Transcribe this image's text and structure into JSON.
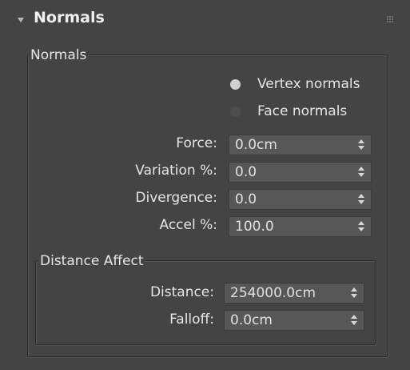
{
  "rollout": {
    "title": "Normals"
  },
  "group_normals": {
    "label": "Normals",
    "radio_vertex": {
      "label": "Vertex normals",
      "selected": true
    },
    "radio_face": {
      "label": "Face normals",
      "selected": false
    },
    "fields": [
      {
        "label": "Force:",
        "value": "0.0cm"
      },
      {
        "label": "Variation %:",
        "value": "0.0"
      },
      {
        "label": "Divergence:",
        "value": "0.0"
      },
      {
        "label": "Accel %:",
        "value": "100.0"
      }
    ]
  },
  "group_distance": {
    "label": "Distance Affect",
    "fields": [
      {
        "label": "Distance:",
        "value": "254000.0cm"
      },
      {
        "label": "Falloff:",
        "value": "0.0cm"
      }
    ]
  }
}
